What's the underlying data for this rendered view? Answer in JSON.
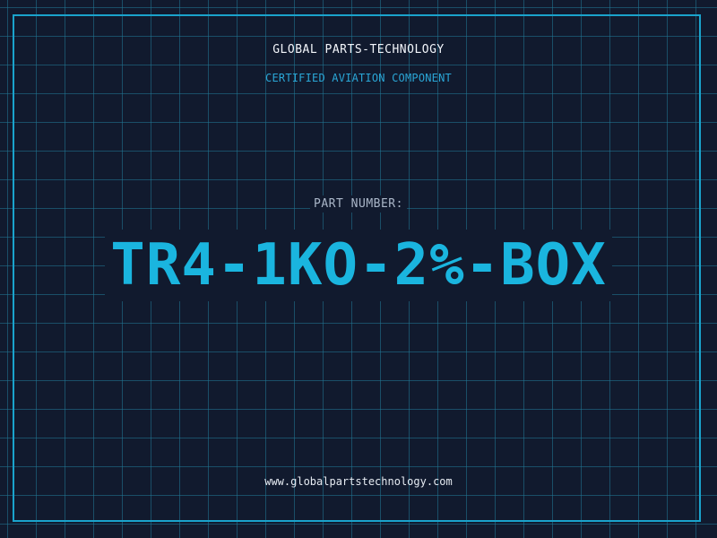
{
  "header": {
    "brand": "GLOBAL PARTS-TECHNOLOGY",
    "tagline": "CERTIFIED AVIATION COMPONENT"
  },
  "part": {
    "label": "PART NUMBER:",
    "number": "TR4-1KO-2%-BOX"
  },
  "footer": {
    "url": "www.globalpartstechnology.com"
  },
  "colors": {
    "background": "#111a2e",
    "accent": "#1ab5df",
    "frame": "#1aa3cc",
    "text": "#f2f5fa"
  }
}
